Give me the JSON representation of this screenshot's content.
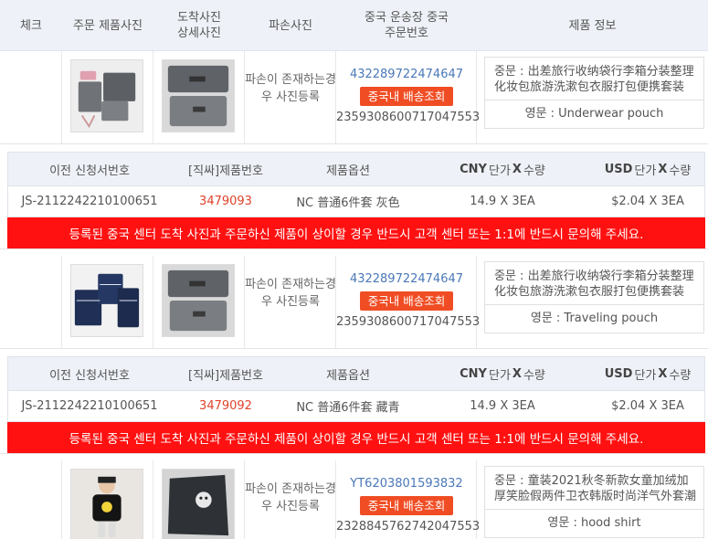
{
  "header": {
    "check": "체크",
    "order_photo": "주문 제품사진",
    "arrival_photo": "도착사진 상세사진",
    "damage_photo": "파손사진",
    "cn_tracking": "중국 운송장 중국 주문번호",
    "product_info": "제품 정보"
  },
  "sub_header": {
    "prev_request": "이전 신청서번호",
    "product_no": "[직싸]제품번호",
    "option": "제품옵션",
    "cny_code": "CNY",
    "cny_text": "단가",
    "cny_x": "X",
    "cny_qty": "수량",
    "usd_code": "USD",
    "usd_text": "단가",
    "usd_x": "X",
    "usd_qty": "수량"
  },
  "damage_text": "파손이 존재하는경우 사진등록",
  "track_button": "중국내 배송조회",
  "warning": "등록된 중국 센터 도착 사진과 주문하신 제품이 상이할 경우 반드시 고객 센터 또는 1:1에 반드시 문의해 주세요.",
  "items": [
    {
      "tracking": "432289722474647",
      "order_no": "2359308600717047553",
      "zh": "중문 : 出差旅行收纳袋行李箱分装整理化妆包旅游洗漱包衣服打包便携套装",
      "en": "영문 : Underwear pouch",
      "prev_request": "JS-2112242210100651",
      "product_no": "3479093",
      "option": "NC 普通6件套 灰色",
      "cny": "14.9 X 3EA",
      "usd": "$2.04 X 3EA"
    },
    {
      "tracking": "432289722474647",
      "order_no": "2359308600717047553",
      "zh": "중문 : 出差旅行收纳袋行李箱分装整理化妆包旅游洗漱包衣服打包便携套装",
      "en": "영문 : Traveling pouch",
      "prev_request": "JS-2112242210100651",
      "product_no": "3479092",
      "option": "NC 普通6件套 藏青",
      "cny": "14.9 X 3EA",
      "usd": "$2.04 X 3EA"
    },
    {
      "tracking": "YT6203801593832",
      "order_no": "2328845762742047553",
      "zh": "중문 : 童装2021秋冬新款女童加绒加厚笑脸假两件卫衣韩版时尚洋气外套潮",
      "en": "영문 : hood shirt"
    }
  ]
}
